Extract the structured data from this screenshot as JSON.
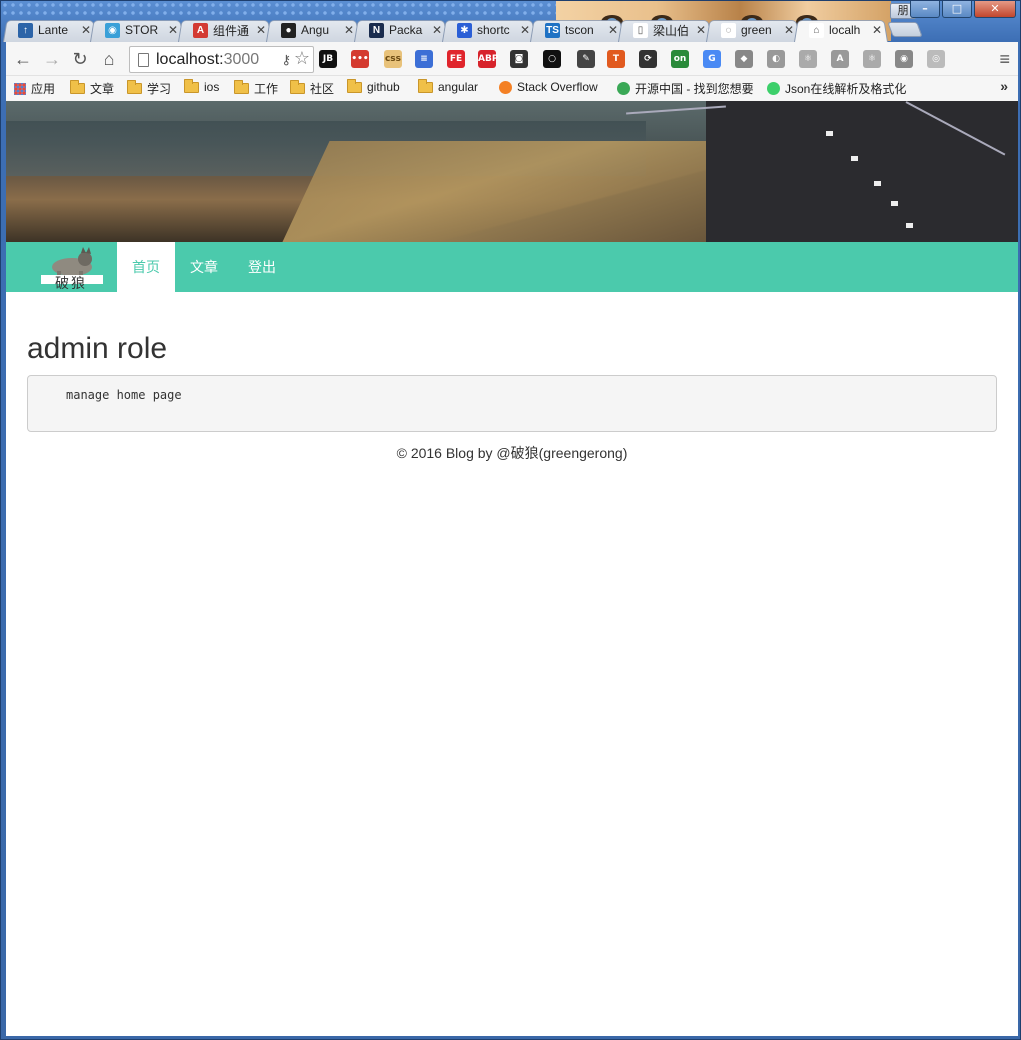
{
  "window": {
    "user_chip": "朋",
    "controls": [
      "–",
      "□",
      "✕"
    ]
  },
  "tabs": [
    {
      "label": "Lante",
      "fav_color": "#2c64a8",
      "fav_glyph": "↑",
      "active": false
    },
    {
      "label": "STOR",
      "fav_color": "#3aa0d8",
      "fav_glyph": "◉",
      "active": false
    },
    {
      "label": "组件通",
      "fav_color": "#d33a33",
      "fav_glyph": "A",
      "active": false
    },
    {
      "label": "Angu",
      "fav_color": "#222222",
      "fav_glyph": "●",
      "active": false
    },
    {
      "label": "Packa",
      "fav_color": "#1a2c4e",
      "fav_glyph": "N",
      "active": false
    },
    {
      "label": "shortc",
      "fav_color": "#2b5fd6",
      "fav_glyph": "✱",
      "active": false
    },
    {
      "label": "tscon",
      "fav_color": "#1f72c4",
      "fav_glyph": "TS",
      "active": false
    },
    {
      "label": "梁山伯",
      "fav_color": "#ffffff",
      "fav_glyph": "▯",
      "active": false
    },
    {
      "label": "green",
      "fav_color": "#ffffff",
      "fav_glyph": "◌",
      "active": false
    },
    {
      "label": "localh",
      "fav_color": "#ffffff",
      "fav_glyph": "⌂",
      "active": true
    }
  ],
  "toolbar": {
    "url_host": "localhost:",
    "url_port": "3000",
    "extensions": [
      {
        "label": "JB",
        "color": "#111111"
      },
      {
        "label": "•••",
        "color": "#d43a2f"
      },
      {
        "label": "css",
        "color": "#e8c27a"
      },
      {
        "label": "≡",
        "color": "#3c6fd6"
      },
      {
        "label": "FE",
        "color": "#e0252c"
      },
      {
        "label": "ABP",
        "color": "#d7232b"
      },
      {
        "label": "◙",
        "color": "#333333"
      },
      {
        "label": "○",
        "color": "#111111"
      },
      {
        "label": "✎",
        "color": "#444444"
      },
      {
        "label": "T",
        "color": "#e15a1f"
      },
      {
        "label": "⟳",
        "color": "#333333"
      },
      {
        "label": "on",
        "color": "#2a8a3a"
      },
      {
        "label": "G",
        "color": "#4a8af4"
      },
      {
        "label": "◆",
        "color": "#888888"
      },
      {
        "label": "◐",
        "color": "#999999"
      },
      {
        "label": "⚛",
        "color": "#aaaaaa"
      },
      {
        "label": "A",
        "color": "#999999"
      },
      {
        "label": "⚛",
        "color": "#aaaaaa"
      },
      {
        "label": "◉",
        "color": "#888888"
      },
      {
        "label": "◎",
        "color": "#bbbbbb"
      }
    ]
  },
  "bookmarks": [
    {
      "label": "应用",
      "type": "apps"
    },
    {
      "label": "文章",
      "type": "folder"
    },
    {
      "label": "学习",
      "type": "folder"
    },
    {
      "label": "ios",
      "type": "folder"
    },
    {
      "label": "工作",
      "type": "folder"
    },
    {
      "label": "社区",
      "type": "folder"
    },
    {
      "label": "github",
      "type": "folder"
    },
    {
      "label": "angular",
      "type": "folder"
    },
    {
      "label": "Stack Overflow",
      "type": "link"
    },
    {
      "label": "开源中国 - 找到您想要",
      "type": "link"
    },
    {
      "label": "Json在线解析及格式化",
      "type": "link"
    }
  ],
  "site": {
    "brand_text": "破狼",
    "nav": [
      {
        "label": "首页",
        "active": true
      },
      {
        "label": "文章",
        "active": false
      },
      {
        "label": "登出",
        "active": false
      }
    ],
    "title": "admin role",
    "pre_text": "manage home page",
    "footer": "© 2016 Blog by @破狼(greengerong)"
  },
  "colors": {
    "accent": "#4bcaac",
    "page_bg": "#ffffff",
    "pre_bg": "#f5f5f5"
  }
}
